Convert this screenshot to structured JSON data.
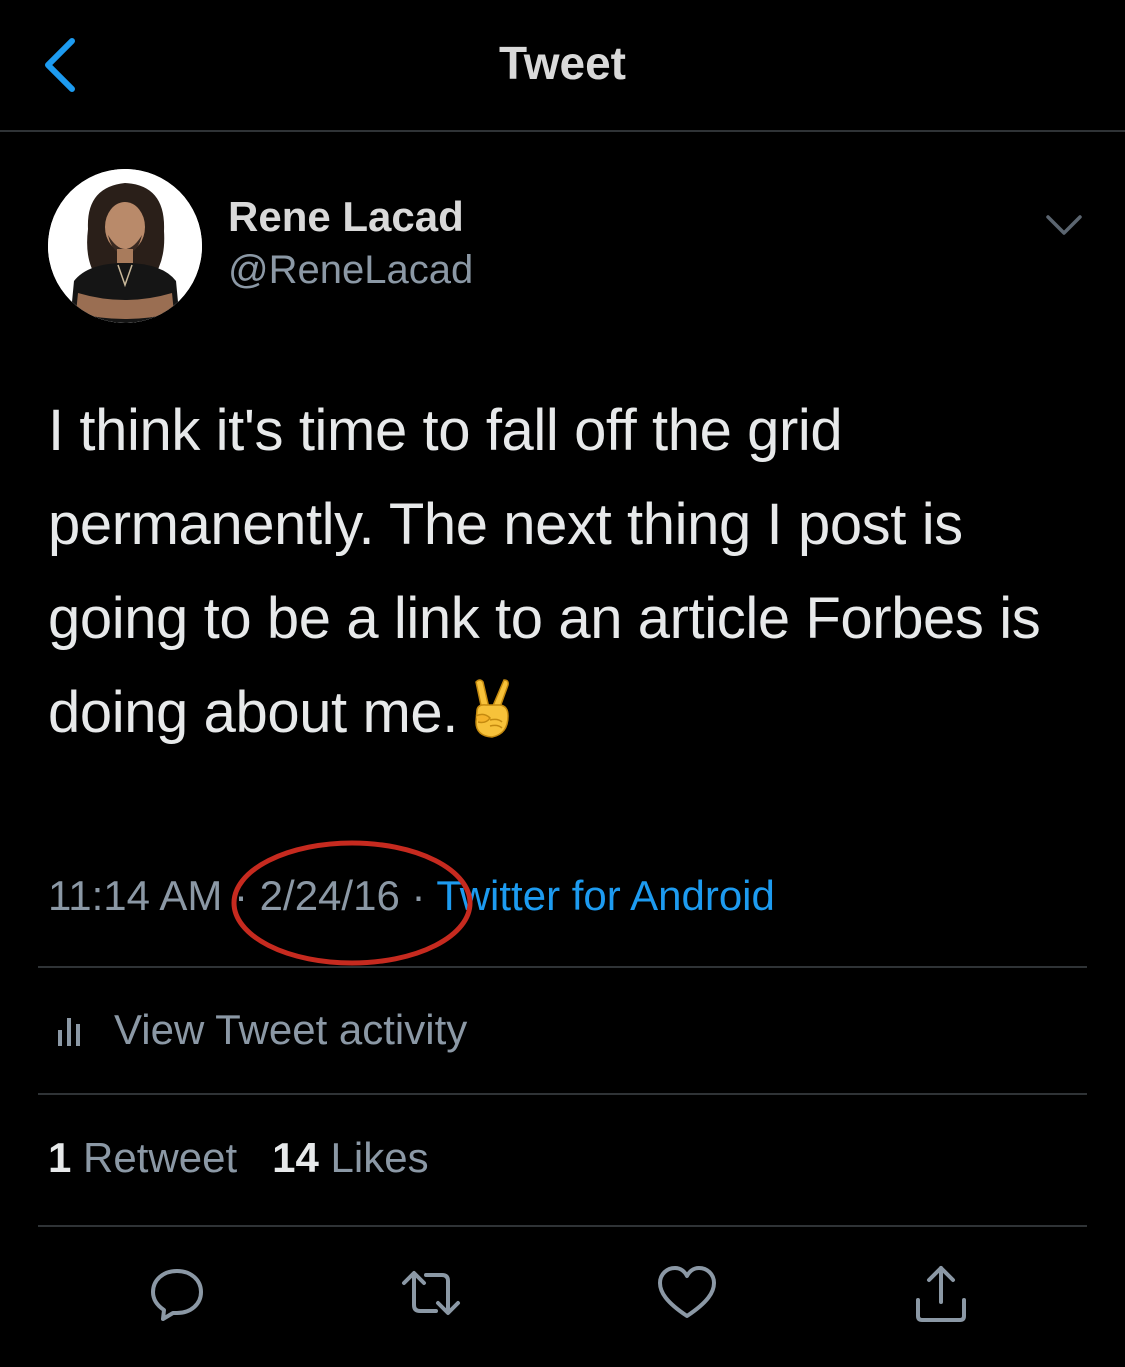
{
  "header": {
    "title": "Tweet",
    "back_icon": "chevron-left-icon"
  },
  "author": {
    "name": "Rene Lacad",
    "handle": "@ReneLacad"
  },
  "tweet": {
    "text": "I think it's time to fall off the grid permanently. The next thing I post is going to be a link to an article Forbes is doing about me.",
    "emoji": "victory-hand-icon"
  },
  "meta": {
    "time": "11:14 AM",
    "separator": " · ",
    "date": "2/24/16",
    "source": "Twitter for Android"
  },
  "activity": {
    "label": "View Tweet activity"
  },
  "stats": {
    "retweets_count": "1",
    "retweets_label": "Retweet",
    "likes_count": "14",
    "likes_label": "Likes"
  },
  "actions": [
    "reply-icon",
    "retweet-icon",
    "like-icon",
    "share-icon"
  ],
  "colors": {
    "background": "#000000",
    "accent": "#1d9bf0",
    "secondary_text": "#8b98a5",
    "annotation": "#c62a1f"
  }
}
